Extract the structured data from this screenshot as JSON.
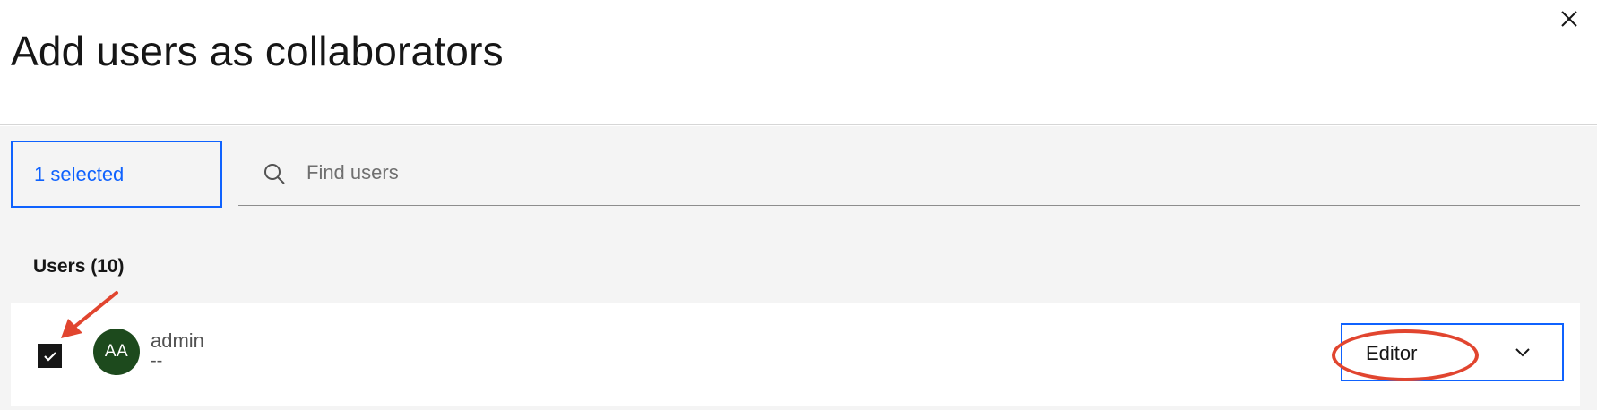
{
  "dialog": {
    "title": "Add users as collaborators",
    "close_icon": "close-icon"
  },
  "selection": {
    "label": "1 selected"
  },
  "search": {
    "placeholder": "Find users",
    "value": "",
    "icon": "search-icon"
  },
  "users_section": {
    "label": "Users (10)",
    "rows": [
      {
        "checked": true,
        "avatar_initials": "AA",
        "avatar_color": "#1d4a1d",
        "name": "admin",
        "subtitle": "--",
        "role": "Editor"
      }
    ]
  },
  "colors": {
    "accent": "#0f62fe",
    "annotation": "#e1452f",
    "background": "#f4f4f4"
  }
}
